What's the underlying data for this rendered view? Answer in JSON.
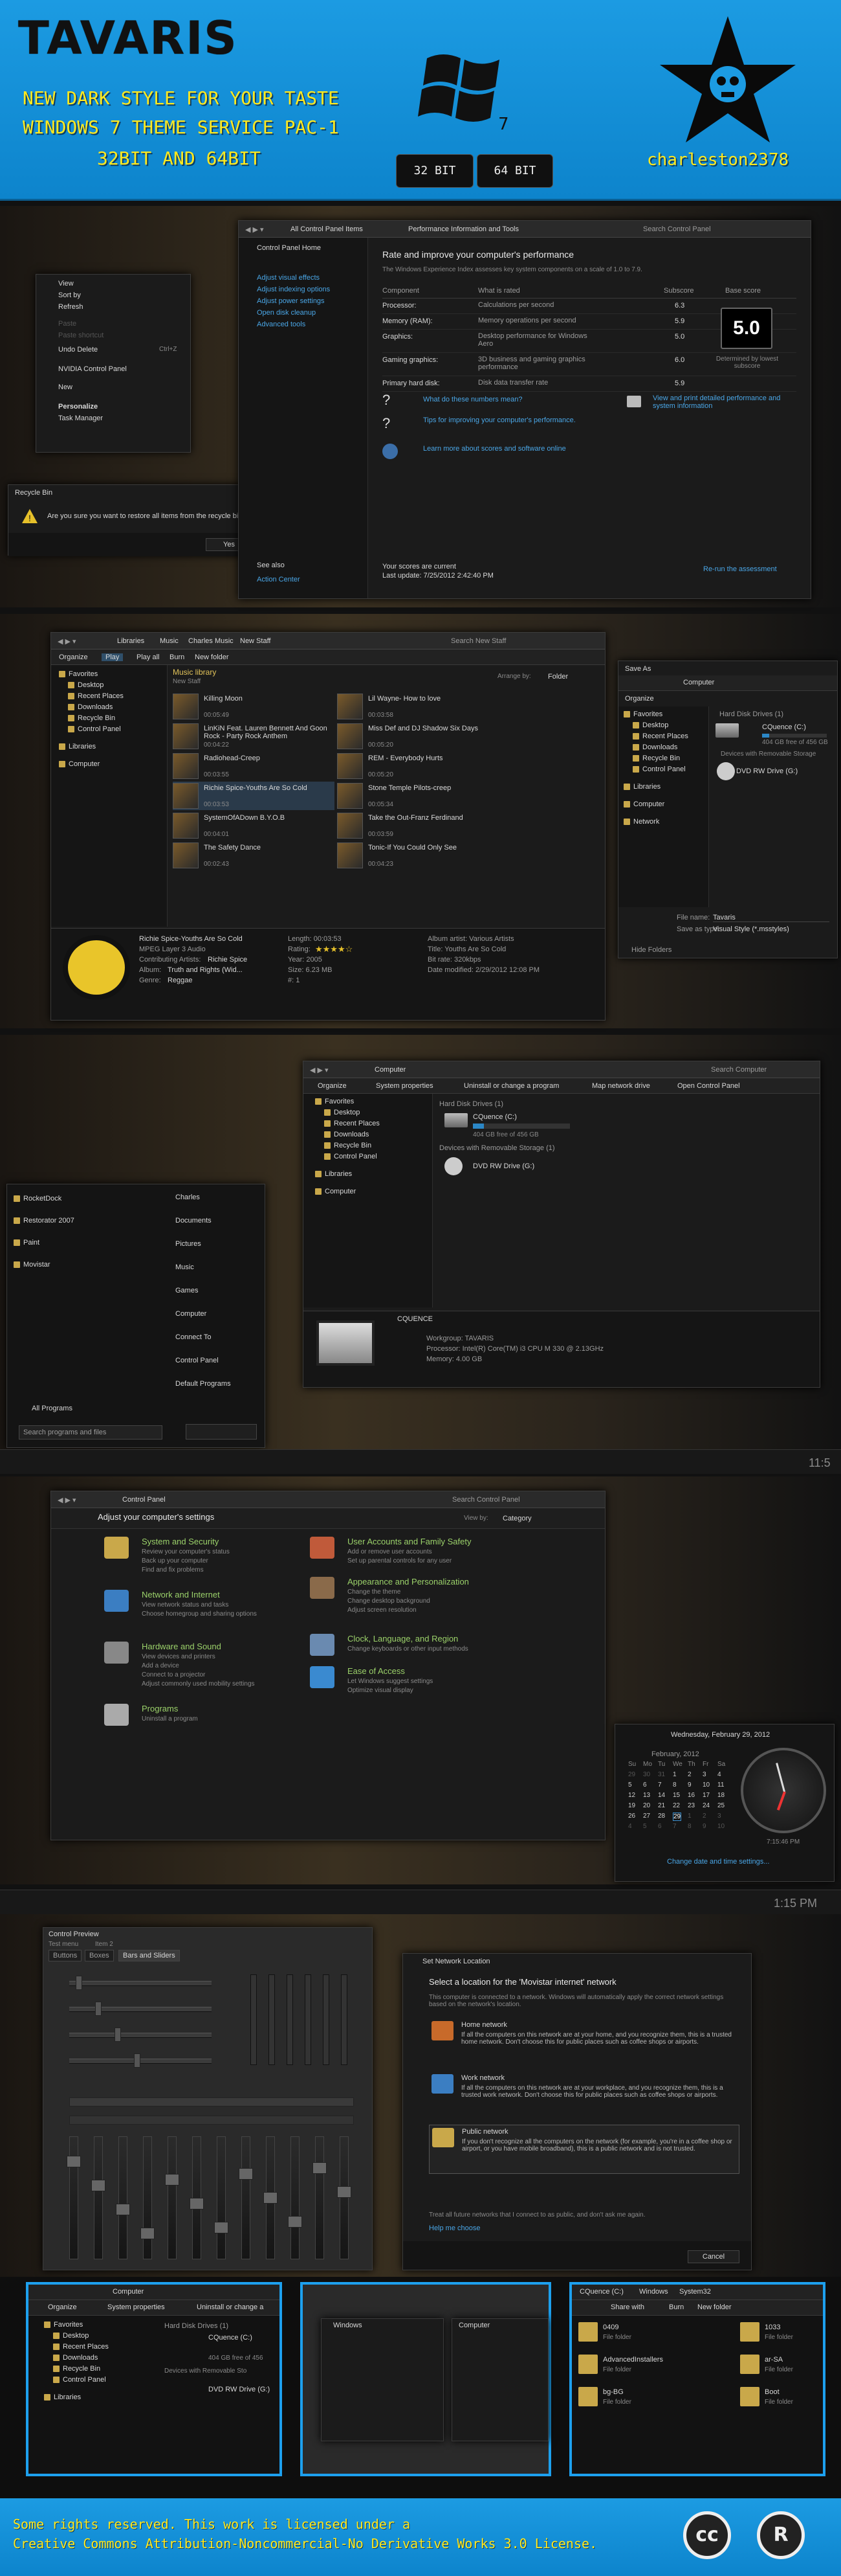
{
  "header": {
    "title": "TAVARIS",
    "line1": "NEW DARK STYLE FOR YOUR TASTE",
    "line2": "WINDOWS 7 THEME SERVICE PAC-1",
    "line3": "32BIT AND 64BIT",
    "btn32": "32 BIT",
    "btn64": "64 BIT",
    "author": "charleston2378",
    "logo_icon": "windows-logo-icon",
    "avatar_icon": "star-skull-icon"
  },
  "s1": {
    "context_menu": [
      "View",
      "Sort by",
      "Refresh",
      "Paste",
      "Paste shortcut",
      "Undo Delete",
      "NVIDIA Control Panel",
      "New",
      "Personalize",
      "Task Manager"
    ],
    "undo_shortcut": "Ctrl+Z",
    "recycle": {
      "title": "Recycle Bin",
      "msg": "Are you sure you want to restore all items from the recycle bin?",
      "yes": "Yes",
      "no": "No"
    },
    "addr": [
      "All Control Panel Items",
      "Performance Information and Tools"
    ],
    "search": "Search Control Panel",
    "side": [
      "Control Panel Home",
      "Adjust visual effects",
      "Adjust indexing options",
      "Adjust power settings",
      "Open disk cleanup",
      "Advanced tools"
    ],
    "seealso": "See also",
    "action": "Action Center",
    "heading": "Rate and improve your computer's performance",
    "sub": "The Windows Experience Index assesses key system components on a scale of 1.0 to 7.9.",
    "cols": [
      "Component",
      "What is rated",
      "Subscore",
      "Base score"
    ],
    "rows": [
      [
        "Processor:",
        "Calculations per second",
        "6.3"
      ],
      [
        "Memory (RAM):",
        "Memory operations per second",
        "5.9"
      ],
      [
        "Graphics:",
        "Desktop performance for Windows Aero",
        "5.0"
      ],
      [
        "Gaming graphics:",
        "3D business and gaming graphics performance",
        "6.0"
      ],
      [
        "Primary hard disk:",
        "Disk data transfer rate",
        "5.9"
      ]
    ],
    "base": "5.0",
    "base_note": "Determined by lowest subscore",
    "links": [
      "What do these numbers mean?",
      "Tips for improving your computer's performance.",
      "Learn more about scores and software online"
    ],
    "print": "View and print detailed performance and system information",
    "current": "Your scores are current",
    "update": "Last update: 7/25/2012 2:42:40 PM",
    "rerun": "Re-run the assessment"
  },
  "s2": {
    "addr": [
      "Libraries",
      "Music",
      "Charles Music",
      "New Staff"
    ],
    "search": "Search New Staff",
    "toolbar": [
      "Organize",
      "Play",
      "Play all",
      "Burn",
      "New folder"
    ],
    "lib_title": "Music library",
    "lib_sub": "New Staff",
    "arrange": "Arrange by:",
    "folder": "Folder",
    "side": [
      "Favorites",
      "Desktop",
      "Recent Places",
      "Downloads",
      "Recycle Bin",
      "Control Panel",
      "Libraries",
      "Computer"
    ],
    "songs": [
      [
        "Killing Moon",
        "00:05:49"
      ],
      [
        "Lil Wayne- How to love",
        "00:03:58"
      ],
      [
        "LinKiN Feat. Lauren Bennett And Goon Rock - Party Rock Anthem",
        "00:04:22"
      ],
      [
        "Miss Def and DJ Shadow Six Days",
        "00:05:20"
      ],
      [
        "Radiohead-Creep",
        "00:03:55"
      ],
      [
        "REM - Everybody Hurts",
        "00:05:20"
      ],
      [
        "Richie Spice-Youths Are So Cold",
        "00:03:53"
      ],
      [
        "Stone Temple Pilots-creep",
        "00:05:34"
      ],
      [
        "SystemOfADown B.Y.O.B",
        "00:04:01"
      ],
      [
        "Take the Out-Franz Ferdinand",
        "00:03:59"
      ],
      [
        "The Safety Dance",
        "00:02:43"
      ],
      [
        "Tonic-If You Could Only See",
        "00:04:23"
      ]
    ],
    "details": {
      "name": "Richie Spice-Youths Are So Cold",
      "type": "MPEG Layer 3 Audio",
      "ctrb": "Contributing Artists:",
      "ctrb_val": "Richie Spice",
      "album": "Album:",
      "album_val": "Truth and Rights (Wid...",
      "genre": "Genre:",
      "genre_val": "Reggae",
      "len": "Length: 00:03:53",
      "rating": "Rating:",
      "year": "Year: 2005",
      "size": "Size: 6.23 MB",
      "num": "#: 1",
      "albart": "Album artist: Various Artists",
      "title": "Title: Youths Are So Cold",
      "bitrate": "Bit rate: 320kbps",
      "date": "Date modified: 2/29/2012 12:08 PM"
    },
    "save": {
      "title": "Save As",
      "addr": "Computer",
      "organize": "Organize",
      "side": [
        "Favorites",
        "Desktop",
        "Recent Places",
        "Downloads",
        "Recycle Bin",
        "Control Panel",
        "Libraries",
        "Computer",
        "Network"
      ],
      "hdd": "Hard Disk Drives (1)",
      "c": "CQuence (C:)",
      "free": "404 GB free of 456 GB",
      "rem": "Devices with Removable Storage",
      "dvd": "DVD RW Drive (G:)",
      "fname": "File name:",
      "fname_val": "Tavaris",
      "stype": "Save as type:",
      "stype_val": "Visual Style (*.msstyles)",
      "hide": "Hide Folders"
    }
  },
  "s3": {
    "addr": "Computer",
    "search": "Search Computer",
    "toolbar": [
      "Organize",
      "System properties",
      "Uninstall or change a program",
      "Map network drive",
      "Open Control Panel"
    ],
    "side": [
      "Favorites",
      "Desktop",
      "Recent Places",
      "Downloads",
      "Recycle Bin",
      "Control Panel",
      "Libraries",
      "Computer"
    ],
    "hdd": "Hard Disk Drives (1)",
    "c": "CQuence (C:)",
    "free": "404 GB free of 456 GB",
    "rem": "Devices with Removable Storage (1)",
    "dvd": "DVD RW Drive (G:)",
    "pc": "CQUENCE",
    "wg": "Workgroup: TAVARIS",
    "proc": "Processor: Intel(R) Core(TM) i3 CPU     M 330  @ 2.13GHz",
    "mem": "Memory: 4.00 GB",
    "start_left": [
      "RocketDock",
      "Restorator 2007",
      "Paint",
      "Movistar"
    ],
    "start_right": [
      "Charles",
      "Documents",
      "Pictures",
      "Music",
      "Games",
      "Computer",
      "Connect To",
      "Control Panel",
      "Default Programs"
    ],
    "all": "All Programs",
    "search_prog": "Search programs and files",
    "time": "11:5"
  },
  "s4": {
    "addr": "Control Panel",
    "search": "Search Control Panel",
    "heading": "Adjust your computer's settings",
    "view": "View by:",
    "view_val": "Category",
    "cats": [
      {
        "t": "System and Security",
        "l": [
          "Review your computer's status",
          "Back up your computer",
          "Find and fix problems"
        ]
      },
      {
        "t": "Network and Internet",
        "l": [
          "View network status and tasks",
          "Choose homegroup and sharing options"
        ]
      },
      {
        "t": "Hardware and Sound",
        "l": [
          "View devices and printers",
          "Add a device",
          "Connect to a projector",
          "Adjust commonly used mobility settings"
        ]
      },
      {
        "t": "Programs",
        "l": [
          "Uninstall a program"
        ]
      },
      {
        "t": "User Accounts and Family Safety",
        "l": [
          "Add or remove user accounts",
          "Set up parental controls for any user"
        ]
      },
      {
        "t": "Appearance and Personalization",
        "l": [
          "Change the theme",
          "Change desktop background",
          "Adjust screen resolution"
        ]
      },
      {
        "t": "Clock, Language, and Region",
        "l": [
          "Change keyboards or other input methods"
        ]
      },
      {
        "t": "Ease of Access",
        "l": [
          "Let Windows suggest settings",
          "Optimize visual display"
        ]
      }
    ],
    "cal": {
      "date": "Wednesday, February 29, 2012",
      "month": "February, 2012",
      "days": [
        "Su",
        "Mo",
        "Tu",
        "We",
        "Th",
        "Fr",
        "Sa"
      ],
      "nums": [
        "29",
        "30",
        "31",
        "1",
        "2",
        "3",
        "4",
        "5",
        "6",
        "7",
        "8",
        "9",
        "10",
        "11",
        "12",
        "13",
        "14",
        "15",
        "16",
        "17",
        "18",
        "19",
        "20",
        "21",
        "22",
        "23",
        "24",
        "25",
        "26",
        "27",
        "28",
        "29",
        "1",
        "2",
        "3",
        "4",
        "5",
        "6",
        "7",
        "8",
        "9",
        "10"
      ],
      "time": "7:15:46 PM",
      "link": "Change date and time settings..."
    }
  },
  "s5": {
    "time": "1:15 PM",
    "preview": {
      "title": "Control Preview",
      "menu": [
        "Test menu",
        "Item 2"
      ],
      "tabs": [
        "Buttons",
        "Boxes",
        "Bars and Sliders"
      ]
    },
    "net": {
      "title": "Set Network Location",
      "heading": "Select a location for the 'Movistar internet' network",
      "desc": "This computer is connected to a network. Windows will automatically apply the correct network settings based on the network's location.",
      "opts": [
        {
          "t": "Home network",
          "d": "If all the computers on this network are at your home, and you recognize them, this is a trusted home network. Don't choose this for public places such as coffee shops or airports."
        },
        {
          "t": "Work network",
          "d": "If all the computers on this network are at your workplace, and you recognize them, this is a trusted work network. Don't choose this for public places such as coffee shops or airports."
        },
        {
          "t": "Public network",
          "d": "If you don't recognize all the computers on the network (for example, you're in a coffee shop or airport, or you have mobile broadband), this is a public network and is not trusted."
        }
      ],
      "chk": "Treat all future networks that I connect to as public, and don't ask me again.",
      "help": "Help me choose",
      "cancel": "Cancel"
    }
  },
  "s6": {
    "m1": {
      "addr": "Computer",
      "tb": [
        "Organize",
        "System properties",
        "Uninstall or change a"
      ],
      "side": [
        "Favorites",
        "Desktop",
        "Recent Places",
        "Downloads",
        "Recycle Bin",
        "Control Panel",
        "Libraries"
      ],
      "hdd": "Hard Disk Drives (1)",
      "c": "CQuence (C:)",
      "free": "404 GB free of 456",
      "rem": "Devices with Removable Sto",
      "dvd": "DVD RW Drive (G:)"
    },
    "m2": {
      "a": "Windows",
      "b": "Computer"
    },
    "m3": {
      "addr": [
        "CQuence (C:)",
        "Windows",
        "System32"
      ],
      "tb": [
        "Share with",
        "Burn",
        "New folder"
      ],
      "items": [
        [
          "0409",
          "File folder"
        ],
        [
          "1033",
          "File folder"
        ],
        [
          "AdvancedInstallers",
          "File folder"
        ],
        [
          "ar-SA",
          "File folder"
        ],
        [
          "bg-BG",
          "File folder"
        ],
        [
          "Boot",
          "File folder"
        ]
      ]
    }
  },
  "footer": {
    "l1": "Some rights reserved. This work is licensed under a",
    "l2": "Creative Commons Attribution-Noncommercial-No Derivative Works 3.0 License.",
    "cc": "cc",
    "r": "R"
  },
  "colors": {
    "accent": "#1da0ee",
    "yellow": "#ffe91f"
  }
}
